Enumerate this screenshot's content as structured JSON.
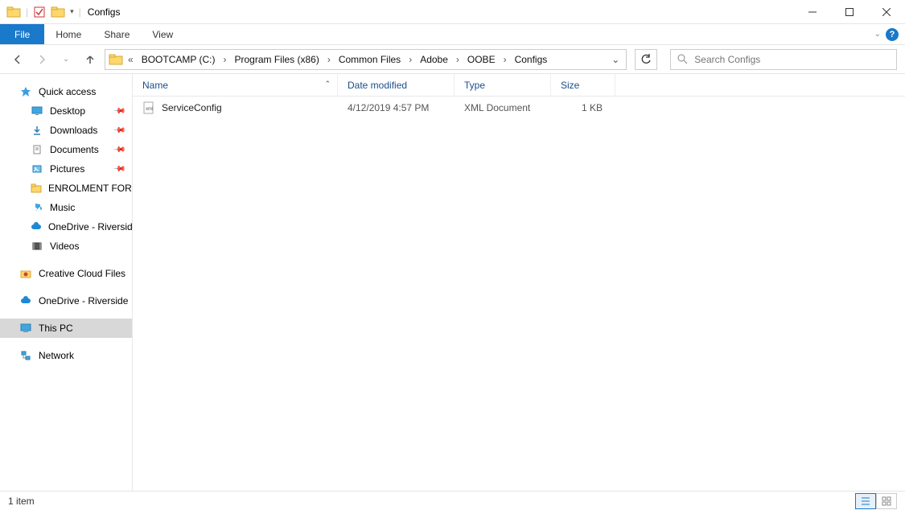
{
  "title": "Configs",
  "ribbon": {
    "file": "File",
    "home": "Home",
    "share": "Share",
    "view": "View"
  },
  "breadcrumbs": [
    "BOOTCAMP (C:)",
    "Program Files (x86)",
    "Common Files",
    "Adobe",
    "OOBE",
    "Configs"
  ],
  "search_placeholder": "Search Configs",
  "columns": {
    "name": "Name",
    "date": "Date modified",
    "type": "Type",
    "size": "Size"
  },
  "files": [
    {
      "name": "ServiceConfig",
      "date": "4/12/2019 4:57 PM",
      "type": "XML Document",
      "size": "1 KB"
    }
  ],
  "sidebar": {
    "quick_access": "Quick access",
    "items": [
      {
        "label": "Desktop",
        "pinned": true
      },
      {
        "label": "Downloads",
        "pinned": true
      },
      {
        "label": "Documents",
        "pinned": true
      },
      {
        "label": "Pictures",
        "pinned": true
      },
      {
        "label": "ENROLMENT FORM",
        "pinned": false
      },
      {
        "label": "Music",
        "pinned": false
      },
      {
        "label": "OneDrive - Riverside",
        "pinned": false
      },
      {
        "label": "Videos",
        "pinned": false
      }
    ],
    "creative": "Creative Cloud Files",
    "onedrive": "OneDrive - Riverside",
    "thispc": "This PC",
    "network": "Network"
  },
  "status": "1 item"
}
